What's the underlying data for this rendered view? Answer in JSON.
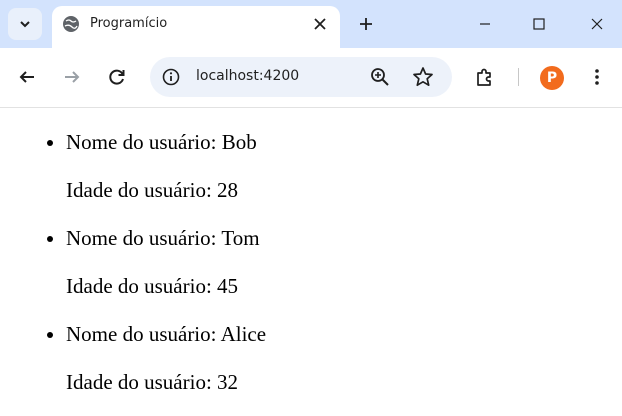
{
  "browser": {
    "tab": {
      "title": "Programício"
    },
    "omnibox": {
      "url": "localhost:4200"
    }
  },
  "page": {
    "users": [
      {
        "name_label": "Nome do usuário: Bob",
        "age_label": "Idade do usuário: 28"
      },
      {
        "name_label": "Nome do usuário: Tom",
        "age_label": "Idade do usuário: 45"
      },
      {
        "name_label": "Nome do usuário: Alice",
        "age_label": "Idade do usuário: 32"
      }
    ]
  },
  "icons": {
    "tab_search": "chevron-down-icon",
    "favicon": "globe-icon",
    "close": "close-icon",
    "new_tab": "plus-icon",
    "back": "back-arrow-icon",
    "forward": "forward-arrow-icon",
    "reload": "reload-icon",
    "site_info": "info-icon",
    "zoom": "zoom-in-icon",
    "bookmark": "star-icon",
    "extensions": "puzzle-icon",
    "menu": "kebab-menu-icon"
  },
  "colors": {
    "tabstrip": "#d3e3fd",
    "omnibox": "#edf2fa",
    "profile": "#f26b1d"
  }
}
